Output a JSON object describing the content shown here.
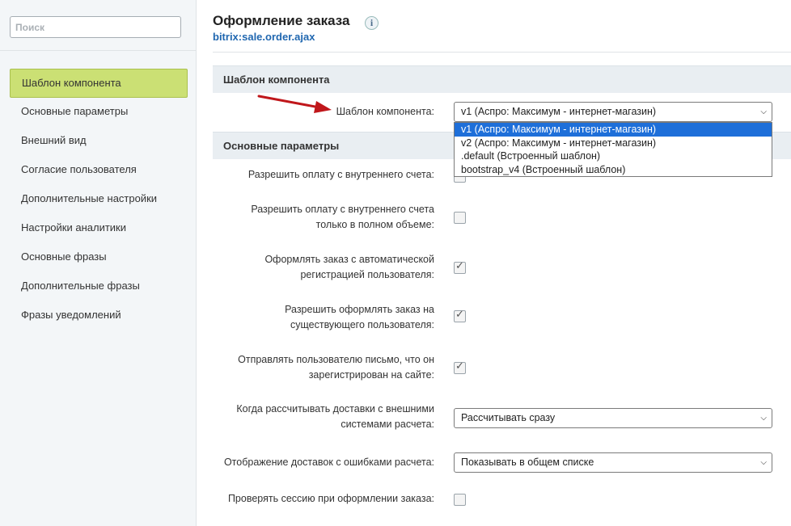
{
  "sidebar": {
    "search_placeholder": "Поиск",
    "items": [
      {
        "label": "Шаблон компонента"
      },
      {
        "label": "Основные параметры"
      },
      {
        "label": "Внешний вид"
      },
      {
        "label": "Согласие пользователя"
      },
      {
        "label": "Дополнительные настройки"
      },
      {
        "label": "Настройки аналитики"
      },
      {
        "label": "Основные фразы"
      },
      {
        "label": "Дополнительные фразы"
      },
      {
        "label": "Фразы уведомлений"
      }
    ]
  },
  "header": {
    "title": "Оформление заказа",
    "info_icon": "i",
    "subtitle": "bitrix:sale.order.ajax"
  },
  "sections": {
    "template": {
      "title": "Шаблон компонента",
      "field_label": "Шаблон компонента:",
      "selected": "v1 (Аспро: Максимум - интернет-магазин)",
      "options": [
        "v1 (Аспро: Максимум - интернет-магазин)",
        "v2 (Аспро: Максимум - интернет-магазин)",
        ".default (Встроенный шаблон)",
        "bootstrap_v4 (Встроенный шаблон)"
      ]
    },
    "main": {
      "title": "Основные параметры",
      "params": [
        {
          "label": "Разрешить оплату с внутреннего счета:",
          "checked": false
        },
        {
          "label1": "Разрешить оплату с внутреннего счета",
          "label2": "только в полном объеме:",
          "checked": false
        },
        {
          "label1": "Оформлять заказ с автоматической",
          "label2": "регистрацией пользователя:",
          "checked": true
        },
        {
          "label1": "Разрешить оформлять заказ на",
          "label2": "существующего пользователя:",
          "checked": true
        },
        {
          "label1": "Отправлять пользователю письмо, что он",
          "label2": "зарегистрирован на сайте:",
          "checked": true
        },
        {
          "label1": "Когда рассчитывать доставки с внешними",
          "label2": "системами расчета:",
          "value": "Рассчитывать сразу"
        },
        {
          "label": "Отображение доставок с ошибками расчета:",
          "value": "Показывать в общем списке"
        },
        {
          "label": "Проверять сессию при оформлении заказа:",
          "checked": false
        }
      ]
    }
  },
  "colors": {
    "active_nav": "#cbe074",
    "link": "#2067b0",
    "selected_option": "#1e6fd9",
    "annotation_arrow": "#c0171b"
  },
  "icons": {
    "dropdown_arrow": "chevron-down-icon",
    "info": "info-icon",
    "check": "check-icon"
  }
}
